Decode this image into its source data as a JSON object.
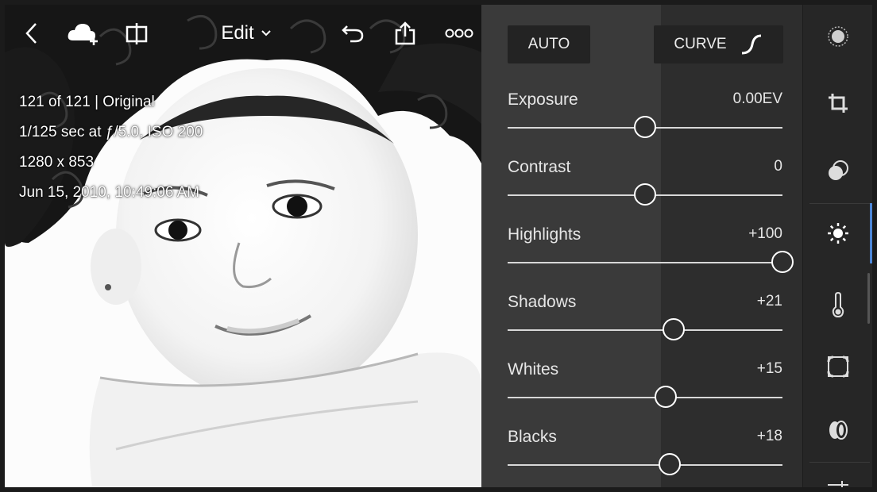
{
  "toolbar": {
    "edit_label": "Edit",
    "icons": [
      "back-chevron-icon",
      "cloud-add-icon",
      "compare-icon",
      "chevron-down-icon",
      "undo-icon",
      "share-icon",
      "more-icon"
    ]
  },
  "photo_info": {
    "count": "121 of 121 | Original",
    "exposure_info": "1/125 sec at ƒ/5.0, ISO 200",
    "dimensions": "1280 x 853",
    "datetime": "Jun 15, 2010, 10:49:06 AM"
  },
  "panel": {
    "auto_label": "AUTO",
    "curve_label": "CURVE",
    "sliders": [
      {
        "label": "Exposure",
        "value": "0.00EV",
        "position": 0.5
      },
      {
        "label": "Contrast",
        "value": "0",
        "position": 0.5
      },
      {
        "label": "Highlights",
        "value": "+100",
        "position": 1.0
      },
      {
        "label": "Shadows",
        "value": "+21",
        "position": 0.605
      },
      {
        "label": "Whites",
        "value": "+15",
        "position": 0.575
      },
      {
        "label": "Blacks",
        "value": "+18",
        "position": 0.59
      }
    ]
  },
  "tools": [
    {
      "name": "presets-icon"
    },
    {
      "name": "crop-icon"
    },
    {
      "name": "color-mix-icon"
    },
    {
      "name": "light-icon",
      "active": true
    },
    {
      "name": "temperature-icon"
    },
    {
      "name": "vignette-icon"
    },
    {
      "name": "lens-icon"
    },
    {
      "name": "adjust-sliders-icon"
    }
  ],
  "colors": {
    "panel_bg": "#3a3a3a",
    "rail_bg": "#262626",
    "active_accent": "#4d86d6"
  }
}
